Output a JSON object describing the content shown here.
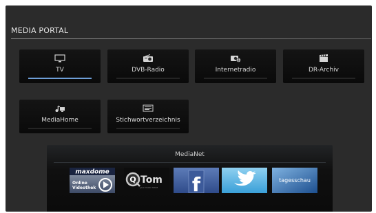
{
  "portal": {
    "title": "MEDIA PORTAL"
  },
  "tiles": [
    {
      "label": "TV",
      "icon": "tv-icon",
      "selected": true
    },
    {
      "label": "DVB-Radio",
      "icon": "radio-icon",
      "selected": false
    },
    {
      "label": "Internetradio",
      "icon": "internet-radio-icon",
      "selected": false
    },
    {
      "label": "DR-Archiv",
      "icon": "clapperboard-icon",
      "selected": false
    },
    {
      "label": "MediaHome",
      "icon": "media-home-icon",
      "selected": false
    },
    {
      "label": "Stichwortverzeichnis",
      "icon": "index-icon",
      "selected": false
    }
  ],
  "medianet": {
    "title": "MediaNet",
    "apps": [
      {
        "name": "maxdome",
        "logo_text": "maxdome",
        "sub_text_1": "Online",
        "sub_text_2": "Videothek"
      },
      {
        "name": "qtom",
        "logo_text": "Tom",
        "sub_text": "your music ticket"
      },
      {
        "name": "facebook",
        "logo_text": "f"
      },
      {
        "name": "twitter",
        "logo_text": ""
      },
      {
        "name": "tagesschau",
        "logo_text": "tagesschau"
      }
    ]
  },
  "colors": {
    "selection_bar": "#6e9fd8",
    "screen_bg": "#2b2b2b",
    "tile_bg": "#0f0f0f"
  }
}
